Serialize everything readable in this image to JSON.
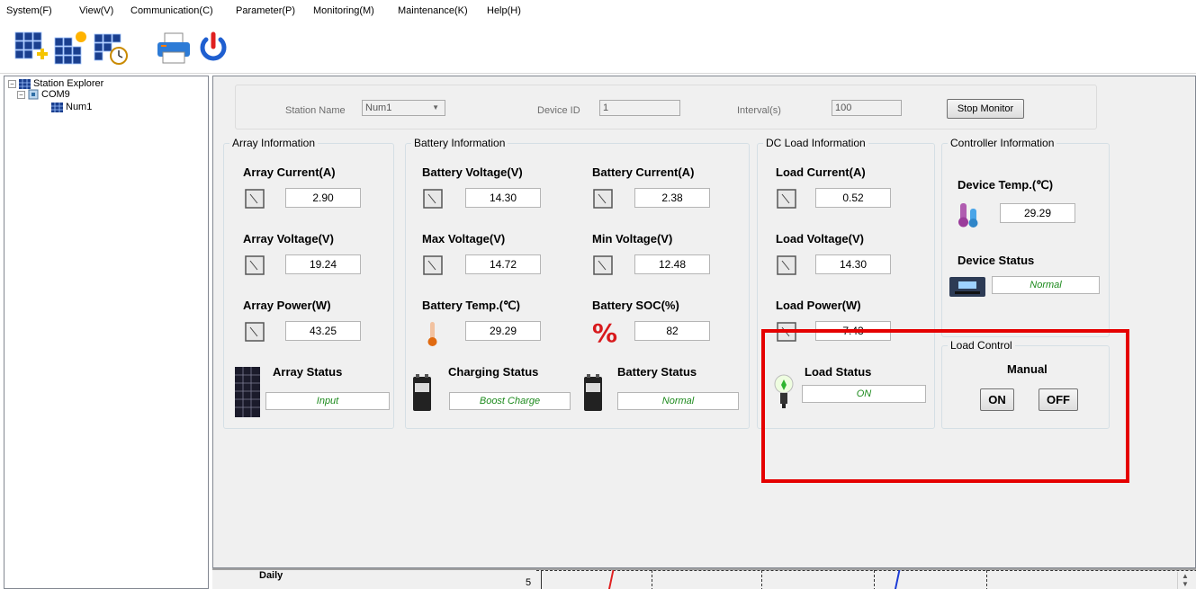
{
  "menu": [
    "System(F)",
    "View(V)",
    "Communication(C)",
    "Parameter(P)",
    "Monitoring(M)",
    "Maintenance(K)",
    "Help(H)"
  ],
  "toolbar_icons": [
    "add-station-icon",
    "sun-panel-icon",
    "schedule-icon",
    "printer-icon",
    "power-icon"
  ],
  "tree": {
    "root": "Station Explorer",
    "port": "COM9",
    "device": "Num1"
  },
  "topbar": {
    "station_name_label": "Station Name",
    "station_name_value": "Num1",
    "device_id_label": "Device ID",
    "device_id_value": "1",
    "interval_label": "Interval(s)",
    "interval_value": "100",
    "stop_button": "Stop Monitor"
  },
  "array": {
    "title": "Array Information",
    "current_label": "Array Current(A)",
    "current": "2.90",
    "voltage_label": "Array Voltage(V)",
    "voltage": "19.24",
    "power_label": "Array Power(W)",
    "power": "43.25",
    "status_label": "Array Status",
    "status": "Input"
  },
  "battery": {
    "title": "Battery Information",
    "voltage_label": "Battery Voltage(V)",
    "voltage": "14.30",
    "current_label": "Battery Current(A)",
    "current": "2.38",
    "max_label": "Max Voltage(V)",
    "max": "14.72",
    "min_label": "Min Voltage(V)",
    "min": "12.48",
    "temp_label": "Battery Temp.(℃)",
    "temp": "29.29",
    "soc_label": "Battery SOC(%)",
    "soc": "82",
    "charging_label": "Charging Status",
    "charging": "Boost Charge",
    "status_label": "Battery Status",
    "status": "Normal"
  },
  "load": {
    "title": "DC Load Information",
    "current_label": "Load Current(A)",
    "current": "0.52",
    "voltage_label": "Load Voltage(V)",
    "voltage": "14.30",
    "power_label": "Load Power(W)",
    "power": "7.43",
    "status_label": "Load Status",
    "status": "ON"
  },
  "controller": {
    "title": "Controller Information",
    "temp_label": "Device Temp.(℃)",
    "temp": "29.29",
    "status_label": "Device Status",
    "status": "Normal"
  },
  "load_control": {
    "title": "Load Control",
    "mode": "Manual",
    "on": "ON",
    "off": "OFF"
  },
  "bottom": {
    "partial_label": "Daily",
    "partial_value": "5"
  },
  "colors": {
    "highlight": "#e50000",
    "status_text": "#1c8a1c",
    "panel_bg": "#f0f0f0"
  }
}
